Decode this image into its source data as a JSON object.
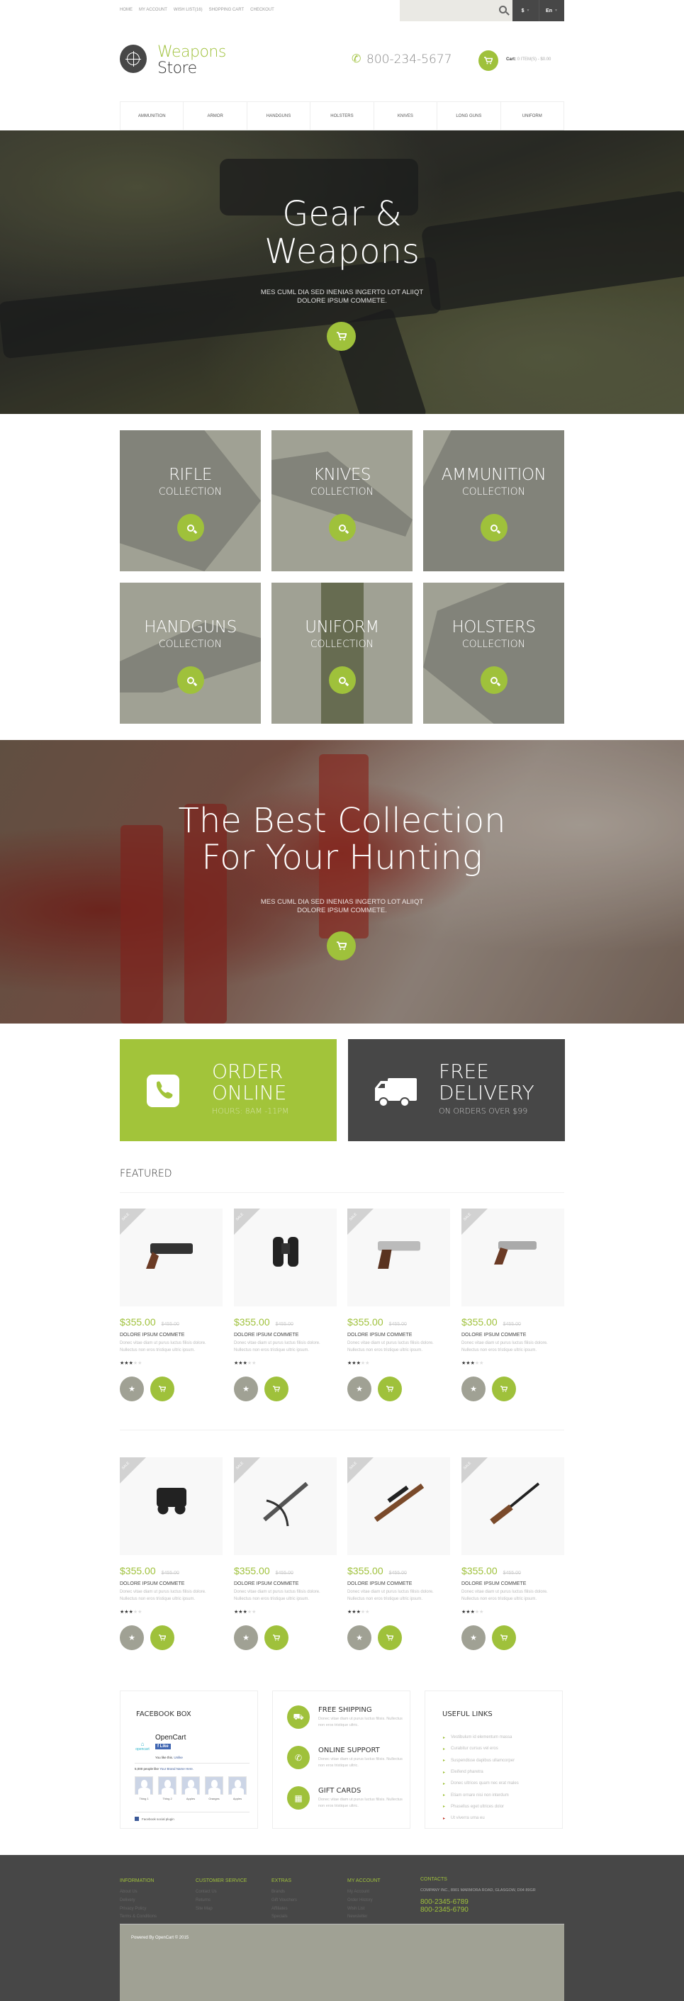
{
  "topbar": {
    "links": [
      "Home",
      "My Account",
      "Wish List(16)",
      "Shopping Cart",
      "Checkout"
    ],
    "search_placeholder": "",
    "currency": "$",
    "language": "En"
  },
  "header": {
    "logo_line1": "Weapons",
    "logo_line2": "Store",
    "phone": "800-234-5677",
    "cart_label": "Cart:",
    "cart_value": "0 ITEM(S) - $0.00"
  },
  "nav": [
    "Ammunition",
    "Armor",
    "Handguns",
    "Holsters",
    "Knives",
    "Long Guns",
    "Uniform"
  ],
  "hero1": {
    "title_line1": "Gear &",
    "title_line2": "Weapons",
    "subtitle_line1": "Mes cuml dia sed inenias ingerto lot aliiqt",
    "subtitle_line2": "dolore ipsum commete."
  },
  "collections": [
    {
      "title": "RIFLE",
      "subtitle": "COLLECTION"
    },
    {
      "title": "KNIVES",
      "subtitle": "COLLECTION"
    },
    {
      "title": "AMMUNITION",
      "subtitle": "COLLECTION"
    },
    {
      "title": "HANDGUNS",
      "subtitle": "COLLECTION"
    },
    {
      "title": "UNIFORM",
      "subtitle": "COLLECTION"
    },
    {
      "title": "HOLSTERS",
      "subtitle": "COLLECTION"
    }
  ],
  "hero2": {
    "title_line1": "The Best Collection",
    "title_line2": "For Your Hunting",
    "subtitle_line1": "Mes cuml dia sed inenias ingerto lot aliiqt",
    "subtitle_line2": "dolore ipsum commete."
  },
  "promos": [
    {
      "title_line1": "ORDER",
      "title_line2": "ONLINE",
      "subtitle": "HOURS: 8AM -11PM"
    },
    {
      "title_line1": "FREE",
      "title_line2": "DELIVERY",
      "subtitle": "ON ORDERS OVER $99"
    }
  ],
  "featured": {
    "heading": "FEATURED",
    "sale_label": "SALE",
    "products": [
      {
        "image": "revolver",
        "price": "$355.00",
        "old_price": "$455.00",
        "name": "Dolore ipsum commete",
        "desc": "Donec vitae diam ut purus luctus filisis dolore. Nullectus non eros tristique ultric ipsum.",
        "rating": 3
      },
      {
        "image": "binoculars",
        "price": "$355.00",
        "old_price": "$455.00",
        "name": "Dolore ipsum commete",
        "desc": "Donec vitae diam ut purus luctus filisis dolore. Nullectus non eros tristique ultric ipsum.",
        "rating": 3
      },
      {
        "image": "pistol",
        "price": "$355.00",
        "old_price": "$455.00",
        "name": "Dolore ipsum commete",
        "desc": "Donec vitae diam ut purus luctus filisis dolore. Nullectus non eros tristique ultric ipsum.",
        "rating": 3
      },
      {
        "image": "revolver-silver",
        "price": "$355.00",
        "old_price": "$455.00",
        "name": "Dolore ipsum commete",
        "desc": "Donec vitae diam ut purus luctus filisis dolore. Nullectus non eros tristique ultric ipsum.",
        "rating": 3
      },
      {
        "image": "binoculars-compact",
        "price": "$355.00",
        "old_price": "$455.00",
        "name": "Dolore ipsum commete",
        "desc": "Donec vitae diam ut purus luctus filisis dolore. Nullectus non eros tristique ultric ipsum.",
        "rating": 3
      },
      {
        "image": "crossbow",
        "price": "$355.00",
        "old_price": "$455.00",
        "name": "Dolore ipsum commete",
        "desc": "Donec vitae diam ut purus luctus filisis dolore. Nullectus non eros tristique ultric ipsum.",
        "rating": 3
      },
      {
        "image": "scoped-rifle",
        "price": "$355.00",
        "old_price": "$455.00",
        "name": "Dolore ipsum commete",
        "desc": "Donec vitae diam ut purus luctus filisis dolore. Nullectus non eros tristique ultric ipsum.",
        "rating": 3
      },
      {
        "image": "shotgun",
        "price": "$355.00",
        "old_price": "$455.00",
        "name": "Dolore ipsum commete",
        "desc": "Donec vitae diam ut purus luctus filisis dolore. Nullectus non eros tristique ultric ipsum.",
        "rating": 3
      }
    ]
  },
  "facebook": {
    "heading": "FACEBOOK BOX",
    "logo_text": "opencart",
    "page_name": "OpenCart",
    "like_label": "Like",
    "you_like": "You like this.",
    "unlike": "Unlike",
    "count_text": "5,000 people like",
    "brand_link": "Your Brand Name Here.",
    "faces": [
      "Thing 1",
      "Thing 2",
      "Apples",
      "Oranges",
      "Apples"
    ],
    "plugin_label": "Facebook social plugin"
  },
  "services": [
    {
      "icon": "truck-icon",
      "title": "FREE SHIPPING",
      "desc": "Donec vitae diam ut purus luctus filisis. Nullectus non eros tristique ultric."
    },
    {
      "icon": "phone-icon",
      "title": "ONLINE SUPPORT",
      "desc": "Donec vitae diam ut purus luctus filisis. Nullectus non eros tristique ultric."
    },
    {
      "icon": "qr-code-icon",
      "title": "GIFT CARDS",
      "desc": "Donec vitae diam ut purus luctus filisis. Nullectus non eros tristique ultric."
    }
  ],
  "useful_links": {
    "heading": "USEFUL LINKS",
    "items": [
      "Vestibulum id elementum massa",
      "Curabitur cursus vel eros",
      "Suspendisse dapibus ullamcorper",
      "Eleifend pharetra",
      "Donec ultrices quam nec erat males",
      "Etiam ornare nisi non interdum",
      "Phasellus eget ultrices dolor",
      "Ut viverra urna eu"
    ]
  },
  "footer": {
    "columns": [
      {
        "heading": "INFORMATION",
        "links": [
          "About Us",
          "Delivery",
          "Privacy Policy",
          "Terms & Conditions"
        ]
      },
      {
        "heading": "CUSTOMER SERVICE",
        "links": [
          "Contact Us",
          "Returns",
          "Site Map"
        ]
      },
      {
        "heading": "EXTRAS",
        "links": [
          "Brands",
          "Gift Vouchers",
          "Affiliates",
          "Specials"
        ]
      },
      {
        "heading": "MY ACCOUNT",
        "links": [
          "My Account",
          "Order History",
          "Wish List",
          "Newsletter"
        ]
      }
    ],
    "contacts": {
      "heading": "CONTACTS",
      "address": "COMPANY INC., 8901 MARMORA ROAD, GLASGOW, D04 89GR",
      "phone1": "800-2345-6789",
      "phone2": "800-2345-6790"
    },
    "copyright": "Powered By OpenCart  © 2015"
  },
  "colors": {
    "accent": "#9fc13b",
    "dark": "#474747",
    "muted": "#a0a194"
  }
}
